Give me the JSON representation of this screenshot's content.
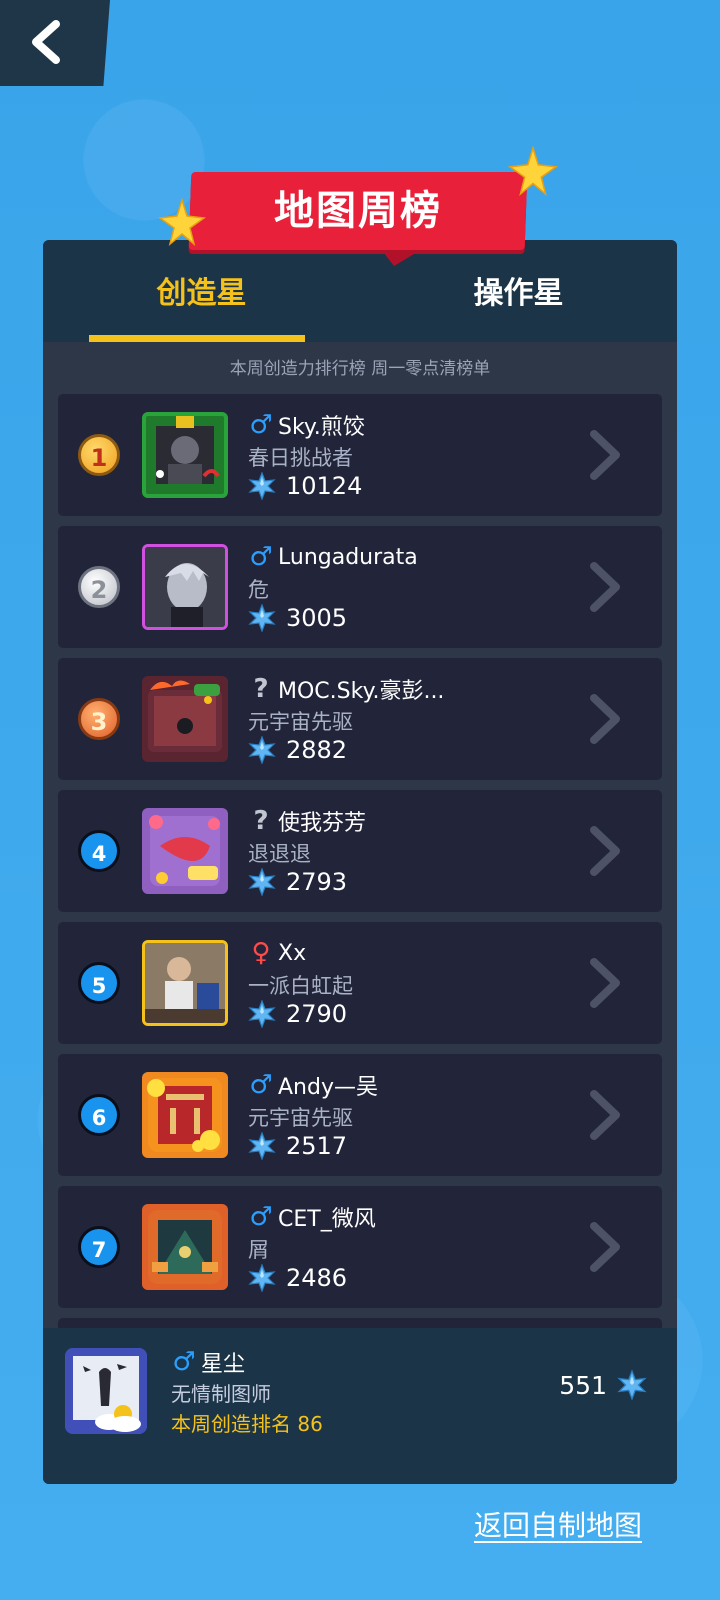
{
  "header": {
    "back_icon": "chevron-left-icon",
    "banner_title": "地图周榜"
  },
  "tabs": [
    {
      "label": "创造星",
      "active": true
    },
    {
      "label": "操作星",
      "active": false
    }
  ],
  "subtitle": "本周创造力排行榜 周一零点清榜单",
  "leaderboard": [
    {
      "rank": "1",
      "rank_style": "gold",
      "gender": "♂",
      "gender_type": "male",
      "name": "Sky.煎饺",
      "title": "春日挑战者",
      "score": "10124"
    },
    {
      "rank": "2",
      "rank_style": "silver",
      "gender": "♂",
      "gender_type": "male",
      "name": "Lungadurata",
      "title": "危",
      "score": "3005"
    },
    {
      "rank": "3",
      "rank_style": "bronze",
      "gender": "?",
      "gender_type": "unknown",
      "name": "MOC.Sky.豪彭...",
      "title": "元宇宙先驱",
      "score": "2882"
    },
    {
      "rank": "4",
      "rank_style": "blue",
      "gender": "?",
      "gender_type": "unknown",
      "name": "使我芬芳",
      "title": "退退退",
      "score": "2793"
    },
    {
      "rank": "5",
      "rank_style": "blue",
      "gender": "♀",
      "gender_type": "female",
      "name": "Xx",
      "title": "一派白虹起",
      "score": "2790"
    },
    {
      "rank": "6",
      "rank_style": "blue",
      "gender": "♂",
      "gender_type": "male",
      "name": "Andy—吴",
      "title": "元宇宙先驱",
      "score": "2517"
    },
    {
      "rank": "7",
      "rank_style": "blue",
      "gender": "♂",
      "gender_type": "male",
      "name": "CET_微风",
      "title": "屑",
      "score": "2486"
    }
  ],
  "me": {
    "gender": "♂",
    "name": "星尘",
    "title": "无情制图师",
    "rank_text": "本周创造排名 86",
    "score": "551"
  },
  "footer": {
    "return_link": "返回自制地图"
  },
  "colors": {
    "background": "#3da6ea",
    "accent_yellow": "#f4c21b",
    "banner_red": "#e8203a",
    "panel": "#2d3748",
    "row": "#222539",
    "male": "#29a0ff",
    "female": "#ff4a4a"
  }
}
